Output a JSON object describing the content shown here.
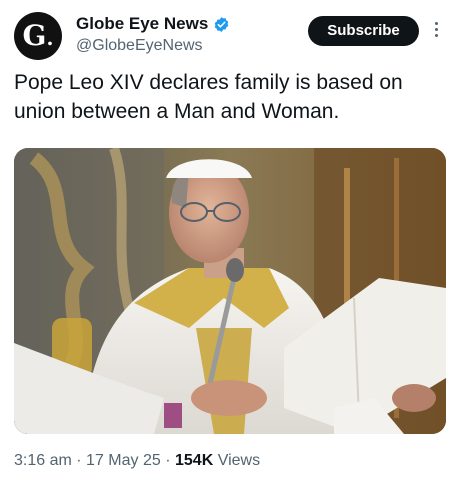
{
  "account": {
    "avatar_letter": "G",
    "avatar_dot": ".",
    "display_name": "Globe Eye News",
    "handle": "@GlobeEyeNews",
    "verified_icon": "verified-badge-icon",
    "brand_color": "#1d9bf0"
  },
  "actions": {
    "subscribe_label": "Subscribe",
    "more_icon": "more-options-icon"
  },
  "tweet": {
    "text": "Pope Leo XIV declares family is based on union between a Man and Woman.",
    "time": "3:16 am",
    "date": "17 May 25",
    "separator": "·",
    "views_count": "154K",
    "views_label": "Views"
  },
  "media": {
    "description_icon": "photo-icon"
  }
}
